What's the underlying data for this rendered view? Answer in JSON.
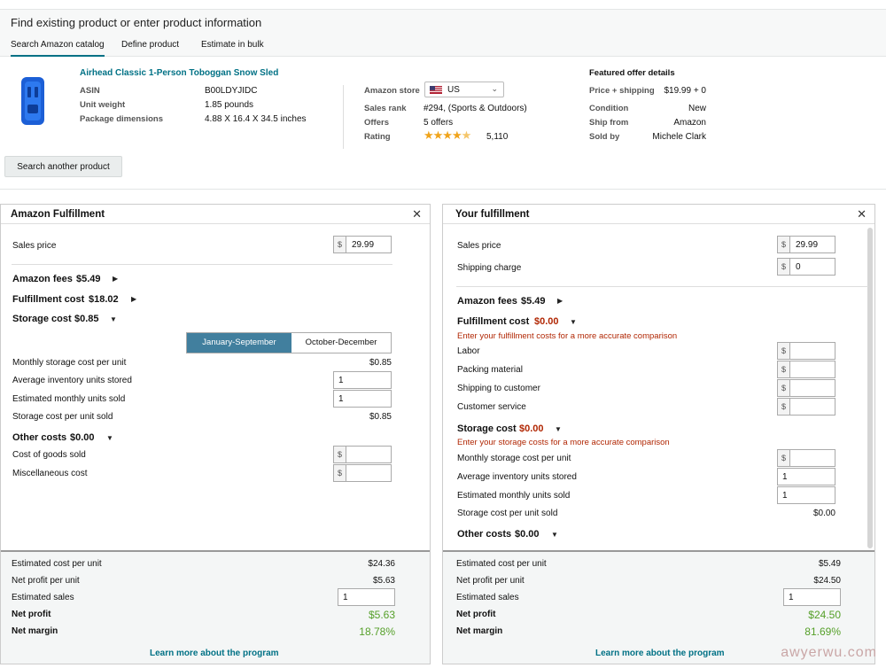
{
  "header": {
    "title": "Find existing product or enter product information",
    "tabs": [
      "Search Amazon catalog",
      "Define product",
      "Estimate in bulk"
    ]
  },
  "product": {
    "name": "Airhead Classic 1-Person Toboggan Snow Sled",
    "asin_label": "ASIN",
    "asin": "B00LDYJIDC",
    "weight_label": "Unit weight",
    "weight": "1.85 pounds",
    "dims_label": "Package dimensions",
    "dims": "4.88 X 16.4 X 34.5 inches",
    "store_label": "Amazon store",
    "store": "US",
    "rank_label": "Sales rank",
    "rank": "#294, (Sports & Outdoors)",
    "offers_label": "Offers",
    "offers": "5 offers",
    "rating_label": "Rating",
    "rating_count": "5,110",
    "rating_stars": 4.5,
    "featured_title": "Featured offer details",
    "price_label": "Price + shipping",
    "price": "$19.99 + 0",
    "condition_label": "Condition",
    "condition": "New",
    "ship_label": "Ship from",
    "ship": "Amazon",
    "sold_label": "Sold by",
    "sold": "Michele Clark",
    "search_button": "Search another product"
  },
  "left": {
    "title": "Amazon Fulfillment",
    "sales_price_label": "Sales price",
    "currency": "$",
    "sales_price": "29.99",
    "amazon_fees_label": "Amazon fees",
    "amazon_fees": "$5.49",
    "fulfillment_label": "Fulfillment cost",
    "fulfillment": "$18.02",
    "storage_label": "Storage cost",
    "storage": "$0.85",
    "seg_a": "January-September",
    "seg_b": "October-December",
    "monthly_label": "Monthly storage cost per unit",
    "monthly": "$0.85",
    "avg_label": "Average inventory units stored",
    "avg": "1",
    "est_label": "Estimated monthly units sold",
    "est": "1",
    "per_unit_label": "Storage cost per unit sold",
    "per_unit": "$0.85",
    "other_label": "Other costs",
    "other": "$0.00",
    "cogs_label": "Cost of goods sold",
    "misc_label": "Miscellaneous cost",
    "foot": {
      "cost_label": "Estimated cost per unit",
      "cost": "$24.36",
      "profit_unit_label": "Net profit per unit",
      "profit_unit": "$5.63",
      "sales_label": "Estimated sales",
      "sales": "1",
      "net_profit_label": "Net profit",
      "net_profit": "$5.63",
      "margin_label": "Net margin",
      "margin": "18.78%"
    },
    "learn": "Learn more about the program"
  },
  "right": {
    "title": "Your fulfillment",
    "sales_price_label": "Sales price",
    "currency": "$",
    "sales_price": "29.99",
    "shipping_label": "Shipping charge",
    "shipping": "0",
    "amazon_fees_label": "Amazon fees",
    "amazon_fees": "$5.49",
    "fulfillment_label": "Fulfillment cost",
    "fulfillment": "$0.00",
    "fulfillment_note": "Enter your fulfillment costs for a more accurate comparison",
    "labor_label": "Labor",
    "packing_label": "Packing material",
    "ship_cust_label": "Shipping to customer",
    "service_label": "Customer service",
    "storage_label": "Storage cost",
    "storage": "$0.00",
    "storage_note": "Enter your storage costs for a more accurate comparison",
    "monthly_label": "Monthly storage cost per unit",
    "avg_label": "Average inventory units stored",
    "avg": "1",
    "est_label": "Estimated monthly units sold",
    "est": "1",
    "per_unit_label": "Storage cost per unit sold",
    "per_unit": "$0.00",
    "other_label": "Other costs",
    "other": "$0.00",
    "foot": {
      "cost_label": "Estimated cost per unit",
      "cost": "$5.49",
      "profit_unit_label": "Net profit per unit",
      "profit_unit": "$24.50",
      "sales_label": "Estimated sales",
      "sales": "1",
      "net_profit_label": "Net profit",
      "net_profit": "$24.50",
      "margin_label": "Net margin",
      "margin": "81.69%"
    },
    "learn": "Learn more about the program"
  },
  "watermark": "awyerwu.com",
  "colors": {
    "link": "#007185",
    "error": "#b12704",
    "positive": "#56a02a",
    "segment_active": "#417f9e"
  }
}
